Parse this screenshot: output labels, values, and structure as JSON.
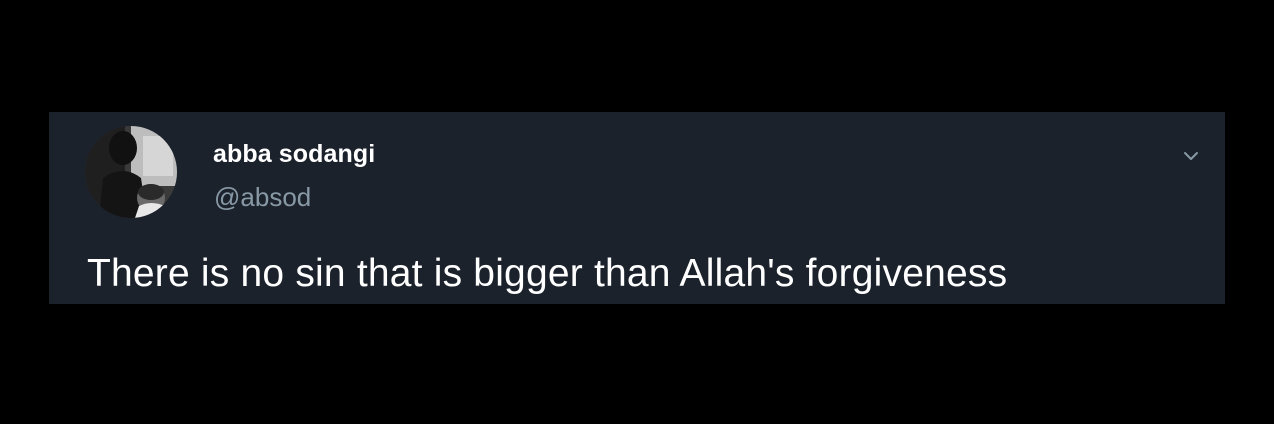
{
  "tweet": {
    "author": {
      "display_name": "abba sodangi",
      "handle": "@absod"
    },
    "text": "There is no sin that is bigger than Allah's forgiveness",
    "menu_icon": "chevron-down-icon"
  },
  "colors": {
    "page_background": "#000000",
    "card_background": "#1b222c",
    "primary_text": "#ffffff",
    "secondary_text": "#8899a6"
  }
}
